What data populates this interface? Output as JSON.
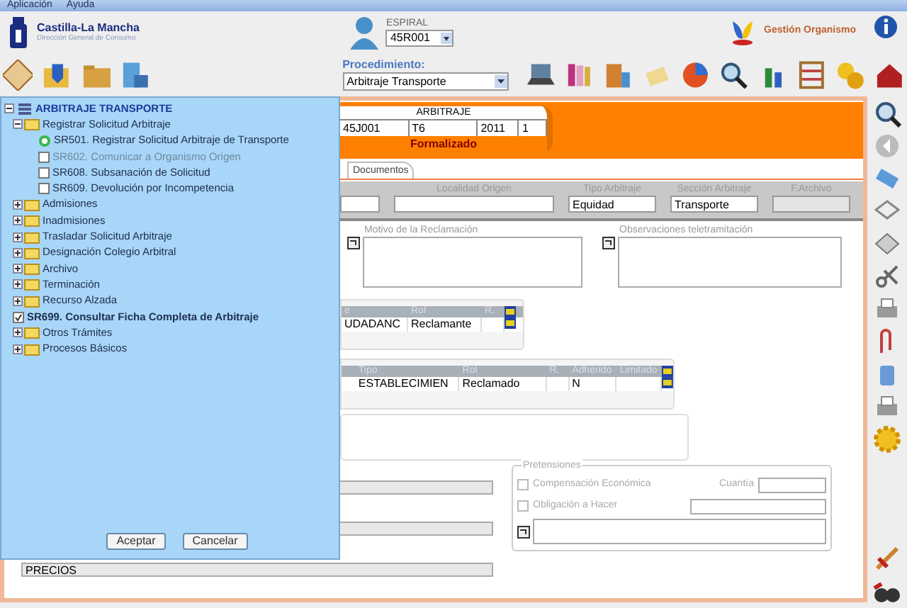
{
  "menu": [
    {
      "label": "Aplicación"
    },
    {
      "label": "Ayuda"
    }
  ],
  "header": {
    "logo_title": "Castilla-La Mancha",
    "logo_subtitle": "Dirección General de Consumo",
    "user_label": "ESPIRAL",
    "user_select": "45R001",
    "organism": "Gestión Organismo"
  },
  "toolbar": {
    "procedure_label": "Procedimiento:",
    "procedure_select": "Arbitraje Transporte"
  },
  "case": {
    "title": "ARBITRAJE",
    "cells": [
      "45J001",
      "T6",
      "2011",
      "1"
    ],
    "status": "Formalizado"
  },
  "tabs": [
    {
      "label": "Documentos",
      "selected": true
    }
  ],
  "fields": [
    {
      "label": "Localidad Origen",
      "disabled": false
    },
    {
      "label": "Tipo Arbitraje",
      "value": "Equidad",
      "disabled": false
    },
    {
      "label": "Sección Arbitraje",
      "value": "Transporte",
      "disabled": false
    },
    {
      "label": "F.Archivo",
      "disabled": true
    }
  ],
  "notes": [
    {
      "label": "Motivo de la Reclamación"
    },
    {
      "label": "Observaciones teletramitación"
    }
  ],
  "claimants": {
    "columns": [
      "e",
      "Rol",
      "R."
    ],
    "rows": [
      {
        "name": "UDADANC",
        "rol": "Reclamante"
      }
    ]
  },
  "respondents": {
    "columns": [
      "Tipo",
      "Rol",
      "R.",
      "Adherido",
      "Limitado"
    ],
    "rows": [
      {
        "tipo": "ESTABLECIMIEN",
        "rol": "Reclamado",
        "adherido": "N"
      }
    ]
  },
  "bottom_field": {
    "value": "PRECIOS"
  },
  "pretensiones": {
    "title": "Pretensiones",
    "options": [
      {
        "label": "Compensación Económica",
        "checked": false
      },
      {
        "label": "Obligación a Hacer",
        "checked": false
      }
    ],
    "amount_label": "Cuantía"
  },
  "dialog": {
    "tree": [
      {
        "label": "ARBITRAJE TRANSPORTE",
        "kind": "root",
        "expanded": true,
        "children": [
          {
            "label": "Registrar Solicitud Arbitraje",
            "kind": "folder",
            "expanded": true,
            "children": [
              {
                "label": "SR501. Registrar Solicitud Arbitraje de Transporte",
                "kind": "current"
              },
              {
                "label": "SR602. Comunicar a Organismo Origen",
                "kind": "task",
                "checked": false,
                "disabled": true
              },
              {
                "label": "SR608. Subsanación de Solicitud",
                "kind": "task",
                "checked": false,
                "disabled": false
              },
              {
                "label": "SR609. Devolución por Incompetencia",
                "kind": "task",
                "checked": false,
                "disabled": false
              }
            ]
          },
          {
            "label": "Admisiones",
            "kind": "folder",
            "expanded": false
          },
          {
            "label": "Inadmisiones",
            "kind": "folder",
            "expanded": false
          },
          {
            "label": "Trasladar Solicitud Arbitraje",
            "kind": "folder",
            "expanded": false
          },
          {
            "label": "Designación Colegio Arbitral",
            "kind": "folder",
            "expanded": false
          },
          {
            "label": "Archivo",
            "kind": "folder",
            "expanded": false
          },
          {
            "label": "Terminación",
            "kind": "folder",
            "expanded": false
          },
          {
            "label": "Recurso Alzada",
            "kind": "folder",
            "expanded": false
          },
          {
            "label": "SR699. Consultar Ficha Completa de Arbitraje",
            "kind": "task",
            "checked": true,
            "disabled": false
          },
          {
            "label": "Otros Trámites",
            "kind": "folder",
            "expanded": false
          },
          {
            "label": "Procesos Básicos",
            "kind": "folder",
            "expanded": false
          }
        ]
      }
    ],
    "buttons": [
      {
        "label": "Aceptar"
      },
      {
        "label": "Cancelar"
      }
    ]
  }
}
